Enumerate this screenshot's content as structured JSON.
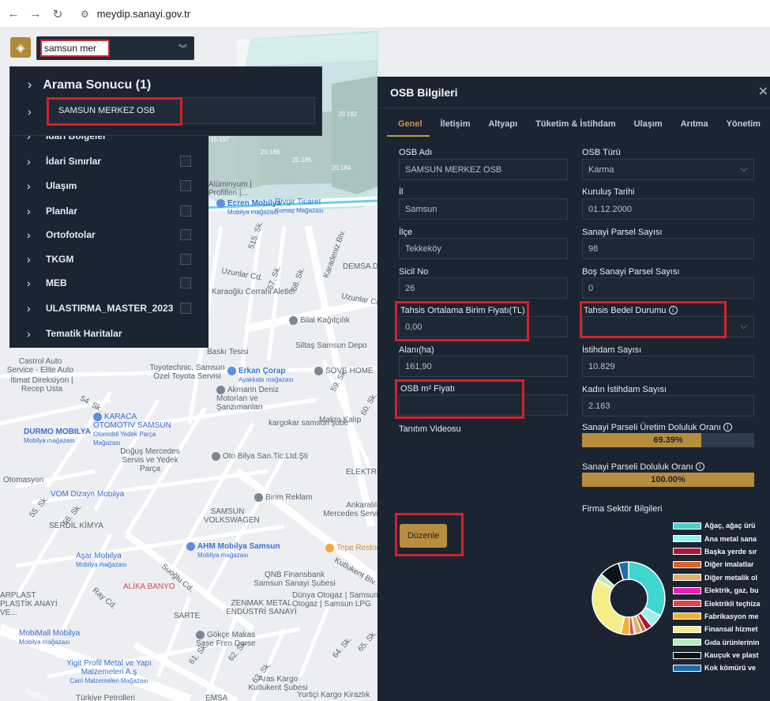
{
  "browser": {
    "url": "meydip.sanayi.gov.tr"
  },
  "search": {
    "value": "samsun mer"
  },
  "results": {
    "title": "Arama Sonucu (1)",
    "item": "SAMSUN MERKEZ OSB"
  },
  "layers": [
    {
      "label": "İdari Bölgeler",
      "checkbox": false
    },
    {
      "label": "İdari Sınırlar",
      "checkbox": true
    },
    {
      "label": "Ulaşım",
      "checkbox": true
    },
    {
      "label": "Planlar",
      "checkbox": true
    },
    {
      "label": "Ortofotolar",
      "checkbox": true
    },
    {
      "label": "TKGM",
      "checkbox": true
    },
    {
      "label": "MEB",
      "checkbox": true
    },
    {
      "label": "ULASTIRMA_MASTER_2023",
      "checkbox": true
    },
    {
      "label": "Tematik Haritalar",
      "checkbox": false
    }
  ],
  "map": {
    "parcels": [
      "20.182",
      "15.197",
      "20.186",
      "20.185",
      "20.184"
    ],
    "poi": [
      {
        "name": "Ecren Mobilya",
        "sub": "Mobilya mağazası",
        "color": "blue"
      },
      {
        "name": "Rivgir Ticaret",
        "sub": "Kumaş Mağazası",
        "color": "blue"
      },
      {
        "name": "Karaoğlu Cerrahi Aletler",
        "sub": "",
        "color": "gray"
      },
      {
        "name": "Bilal Kağıtçılık",
        "sub": "",
        "color": "gray"
      },
      {
        "name": "Siltaş Samsun Depo",
        "sub": "",
        "color": "gray"
      },
      {
        "name": "Castrol Auto Service - Elite Auto",
        "sub": "",
        "color": "gray"
      },
      {
        "name": "Toyotechnic, Samsun Özel Toyota Servisi",
        "sub": "",
        "color": "gray"
      },
      {
        "name": "Erkan Çorap",
        "sub": "Ayakkabı mağazası",
        "color": "blue"
      },
      {
        "name": "SOVE HOME",
        "sub": "",
        "color": "gray"
      },
      {
        "name": "İtimat Direksiyon | Recep Usta",
        "sub": "",
        "color": "gray"
      },
      {
        "name": "Akmarin Deniz Motorları ve Şanzımanları",
        "sub": "",
        "color": "gray"
      },
      {
        "name": "KARACA OTOMOTIV SAMSUN",
        "sub": "Otomobil Yedek Parça Mağazası",
        "color": "blue"
      },
      {
        "name": "DURMO MOBILYA",
        "sub": "Mobilya mağazası",
        "color": "blue"
      },
      {
        "name": "Makro Kalıp",
        "sub": "",
        "color": "gray"
      },
      {
        "name": "kargokar samsun şube",
        "sub": "",
        "color": "gray"
      },
      {
        "name": "Doğuş Mercedes Servis ve Yedek Parça",
        "sub": "",
        "color": "gray"
      },
      {
        "name": "Oto Bilya San.Tic.Ltd.Şti",
        "sub": "",
        "color": "gray"
      },
      {
        "name": "VOM Dizayn Mobilya",
        "sub": "",
        "color": "blue"
      },
      {
        "name": "Birim Reklam",
        "sub": "",
        "color": "gray"
      },
      {
        "name": "Ankaralılar Mercedes Servisi",
        "sub": "",
        "color": "gray"
      },
      {
        "name": "SERDİL KİMYA",
        "sub": "",
        "color": "gray"
      },
      {
        "name": "SAMSUN VOLKSWAGEN",
        "sub": "",
        "color": "gray"
      },
      {
        "name": "AHM Mobilya Samsun",
        "sub": "Mobilya mağazası",
        "color": "blue"
      },
      {
        "name": "Tepe Restoran",
        "sub": "",
        "color": "orange"
      },
      {
        "name": "Aşar Mobilya",
        "sub": "Mobilya mağazası",
        "color": "blue"
      },
      {
        "name": "QNB Finansbank Samsun Sanayi Şubesi",
        "sub": "",
        "color": "gray"
      },
      {
        "name": "ALİKA BANYO",
        "sub": "",
        "color": "pink"
      },
      {
        "name": "ZENMAK METAL ENDÜSTRİ SANAYİ",
        "sub": "",
        "color": "gray"
      },
      {
        "name": "Dünya Otogaz | Samsun Otogaz | Samsun LPG",
        "sub": "",
        "color": "gray"
      },
      {
        "name": "ARPLAST PLASTİK ANAYİ VE...",
        "sub": "",
        "color": "gray"
      },
      {
        "name": "MobiMall Mobilya",
        "sub": "Mobilya mağazası",
        "color": "blue"
      },
      {
        "name": "SARTE",
        "sub": "",
        "color": "gray"
      },
      {
        "name": "Gökçe Makas Şase Fren Dorse",
        "sub": "",
        "color": "gray"
      },
      {
        "name": "Yigit Profil Metal ve Yapı Malzemeleri A.ş",
        "sub": "Cam Malzemeleri Mağazası",
        "color": "blue"
      },
      {
        "name": "Aras Kargo Kutlukent Şubesi",
        "sub": "",
        "color": "gray"
      },
      {
        "name": "Yurtiçi Kargo Kirazlık",
        "sub": "",
        "color": "gray"
      },
      {
        "name": "Türkiye Petrolleri",
        "sub": "",
        "color": "gray"
      },
      {
        "name": "EMSA",
        "sub": "",
        "color": "gray"
      },
      {
        "name": "Otomasyon",
        "sub": "",
        "color": "gray"
      },
      {
        "name": "Alüminyum | Profilleri |...",
        "sub": "",
        "color": "gray"
      },
      {
        "name": "DEMSA De",
        "sub": "",
        "color": "gray"
      },
      {
        "name": "Baskı Tesisi",
        "sub": "",
        "color": "gray"
      },
      {
        "name": "ELEKTRİ",
        "sub": "",
        "color": "gray"
      }
    ],
    "streets": [
      "Uzunlar Cd.",
      "Karadeniz Blv.",
      "Kutlukent Blv.",
      "Suoğlu Cd.",
      "Ray Cd.",
      "57. Sk.",
      "58. Sk.",
      "515. Sk.",
      "55. Sk.",
      "56. Sk.",
      "59. Sk.",
      "60. Sk.",
      "54. Sk.",
      "61. Sk.",
      "62. Sk.",
      "63. Sk.",
      "64. Sk.",
      "65. Sk.",
      "Atatürk",
      "Uzunlar Cd."
    ]
  },
  "osb": {
    "title": "OSB Bilgileri",
    "tabs": [
      "Genel",
      "İletişim",
      "Altyapı",
      "Tüketim & İstihdam",
      "Ulaşım",
      "Arıtma",
      "Yönetim"
    ],
    "fields": {
      "osb_adi": {
        "label": "OSB Adı",
        "value": "SAMSUN MERKEZ OSB"
      },
      "osb_turu": {
        "label": "OSB Türü",
        "value": "Karma"
      },
      "il": {
        "label": "İl",
        "value": "Samsun"
      },
      "kurulus_tarihi": {
        "label": "Kuruluş Tarihi",
        "value": "01.12.2000"
      },
      "ilce": {
        "label": "İlçe",
        "value": "Tekkeköy"
      },
      "sanayi_parsel": {
        "label": "Sanayi Parsel Sayısı",
        "value": "98"
      },
      "sicil_no": {
        "label": "Sicil No",
        "value": "26"
      },
      "bos_parsel": {
        "label": "Boş Sanayi Parsel Sayısı",
        "value": "0"
      },
      "tahsis_fiyat": {
        "label": "Tahsis Ortalama Birim Fiyatı(TL)",
        "value": "0,00"
      },
      "tahsis_bedel": {
        "label": "Tahsis Bedel Durumu",
        "value": ""
      },
      "alan": {
        "label": "Alanı(ha)",
        "value": "161,90"
      },
      "istihdam": {
        "label": "İstihdam Sayısı",
        "value": "10.829"
      },
      "m2_fiyat": {
        "label": "OSB m² Fiyatı",
        "value": ""
      },
      "kadin_istihdam": {
        "label": "Kadın İstihdam Sayısı",
        "value": "2.163"
      },
      "tanitim": {
        "label": "Tanıtım Videosu"
      }
    },
    "uretim_doluluk": {
      "label": "Sanayi Parseli Üretim Doluluk Oranı",
      "value": 69.39,
      "text": "69.39%"
    },
    "doluluk": {
      "label": "Sanayi Parseli Doluluk Oranı",
      "value": 100.0,
      "text": "100.00%"
    },
    "edit_button": "Düzenle",
    "sektor_title": "Firma Sektör Bilgileri"
  },
  "chart_data": {
    "type": "pie",
    "title": "Firma Sektör Bilgileri",
    "donut": true,
    "categories": [
      "Ağaç, ağaç ürü",
      "Ana metal sana",
      "Başka yerde sır",
      "Diğer imalatlar",
      "Diğer metalik ol",
      "Elektrik, gaz, bu",
      "Elektrikli teçhiza",
      "Fabrikasyon me",
      "Finansal hizmet",
      "Gıda ürünlerinin",
      "Kauçuk ve plast",
      "Kok kömürü ve"
    ],
    "colors": [
      "#40d6d0",
      "#9cf0ec",
      "#a8183a",
      "#d8642a",
      "#d9b26a",
      "#e91eb8",
      "#e84050",
      "#f0b030",
      "#f5ee88",
      "#b8ecc0",
      "#0c1418",
      "#1b6fa8"
    ],
    "values": [
      33,
      6,
      3,
      2,
      3,
      0.5,
      2,
      4,
      30,
      3,
      9,
      4.5
    ]
  }
}
